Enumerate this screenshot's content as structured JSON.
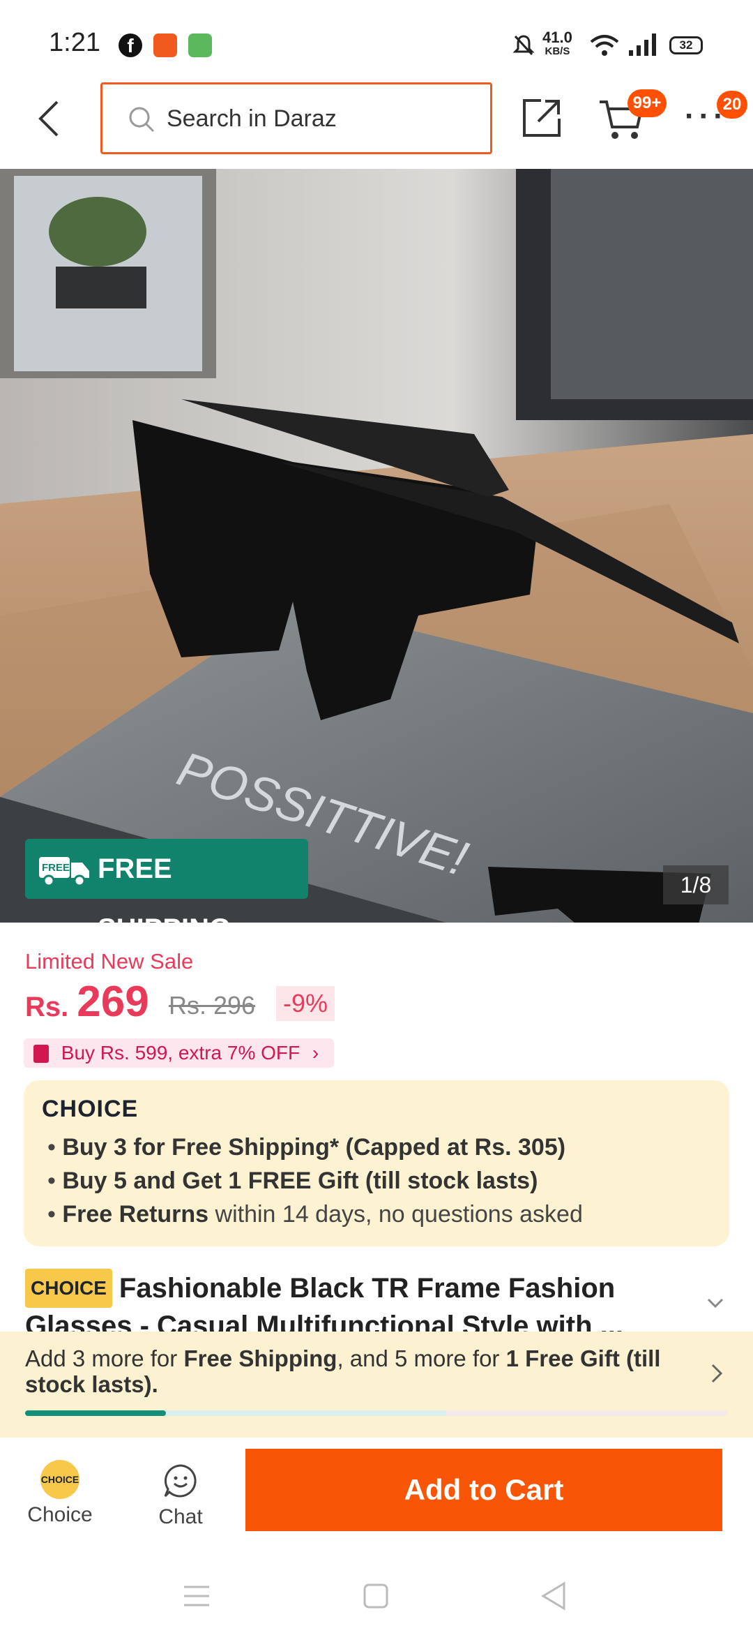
{
  "status_bar": {
    "time": "1:21",
    "net_speed": "41.0",
    "net_unit": "KB/S",
    "battery": "32"
  },
  "header": {
    "search_placeholder": "Search in Daraz",
    "cart_badge": "99+",
    "more_badge": "20"
  },
  "hero": {
    "badge_small": "FREE",
    "free_shipping": "FREE SHIPPING",
    "pager": "1/8",
    "box_text": "POSSITTIVE!",
    "accent": "#11826b"
  },
  "price": {
    "sale_label": "Limited New Sale",
    "currency": "Rs.",
    "amount": "269",
    "original": "Rs. 296",
    "discount": "-9%",
    "promo": "Buy Rs. 599, extra 7% OFF"
  },
  "choice": {
    "logo": "CHOICE",
    "bullet1": "Buy 3 for  Free Shipping* (Capped at Rs. 305)",
    "bullet2": "Buy 5 and Get 1 FREE Gift (till stock lasts)",
    "bullet3_bold": "Free Returns",
    "bullet3_rest": " within 14 days, no questions asked"
  },
  "product": {
    "tag": "CHOICE",
    "title": "Fashionable Black TR Frame Fashion Glasses - Casual Multifunctional Style with ..."
  },
  "shipping_banner": {
    "part1": "Add 3 more for ",
    "part2": "Free Shipping",
    "part3": ", and 5 more for ",
    "part4": "1 Free Gift (till stock lasts)."
  },
  "bottom": {
    "choice_label": "Choice",
    "choice_icon_text": "CHOICE",
    "chat_label": "Chat",
    "add_to_cart": "Add to Cart"
  }
}
